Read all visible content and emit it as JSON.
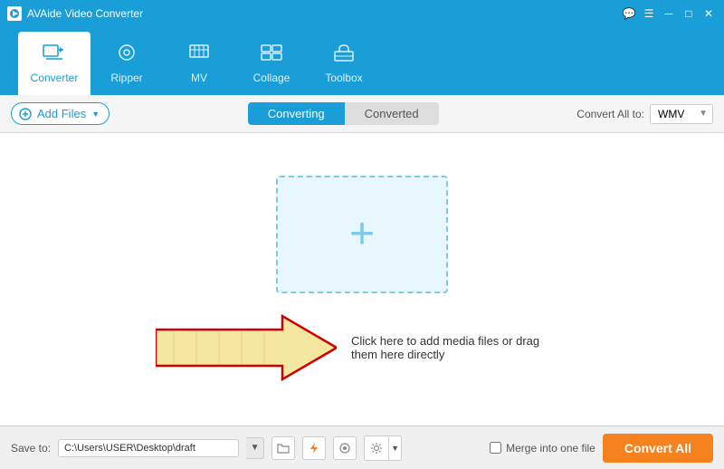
{
  "titleBar": {
    "title": "AVAide Video Converter",
    "controls": [
      "minimize",
      "maximize",
      "close"
    ]
  },
  "nav": {
    "items": [
      {
        "id": "converter",
        "label": "Converter",
        "icon": "⇄",
        "active": true
      },
      {
        "id": "ripper",
        "label": "Ripper",
        "icon": "◎"
      },
      {
        "id": "mv",
        "label": "MV",
        "icon": "▦"
      },
      {
        "id": "collage",
        "label": "Collage",
        "icon": "⊞"
      },
      {
        "id": "toolbox",
        "label": "Toolbox",
        "icon": "⊡"
      }
    ]
  },
  "toolbar": {
    "addFilesLabel": "Add Files",
    "tabs": [
      "Converting",
      "Converted"
    ],
    "activeTab": "Converting",
    "convertAllToLabel": "Convert All to:",
    "selectedFormat": "WMV"
  },
  "dropZone": {
    "plusIcon": "+",
    "instructionText": "Click here to add media files or drag them here directly"
  },
  "statusBar": {
    "saveLabel": "Save to:",
    "savePath": "C:\\Users\\USER\\Desktop\\draft",
    "mergeLabel": "Merge into one file",
    "convertAllLabel": "Convert All"
  }
}
